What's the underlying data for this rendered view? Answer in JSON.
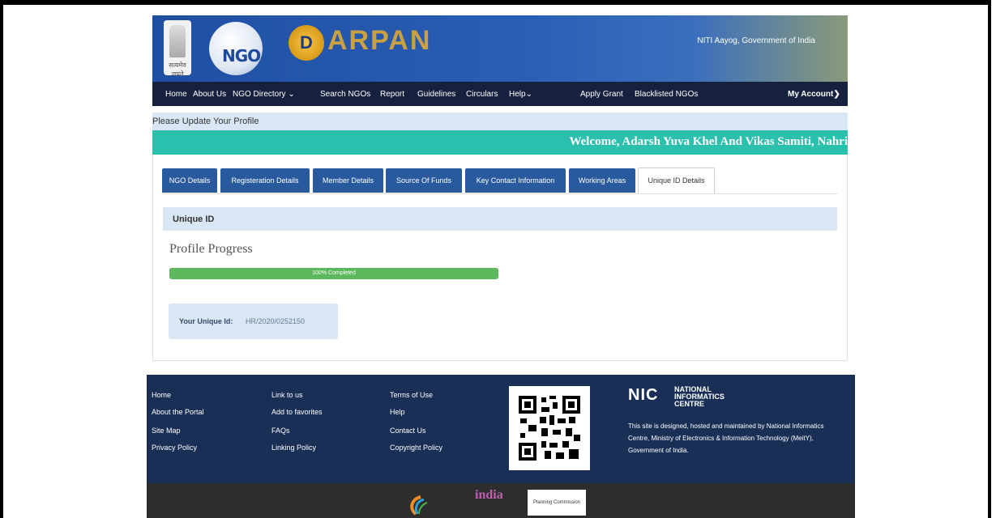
{
  "header": {
    "emblem_text": "सत्यमेव जयते",
    "ngo_logo_text": "NGO",
    "darpan_d": "D",
    "darpan_rest": "ARPAN",
    "org": "NITI Aayog, Government of India"
  },
  "nav": {
    "items": [
      "Home",
      "About Us",
      "NGO Directory",
      "Search NGOs",
      "Report",
      "Guidelines",
      "Circulars",
      "Help",
      "Apply Grant",
      "Blacklisted NGOs"
    ],
    "account": "My Account"
  },
  "notice": "Please Update Your Profile",
  "welcome": "Welcome, Adarsh Yuva Khel And Vikas Samiti, Nahri",
  "tabs": [
    "NGO Details",
    "Registeration Details",
    "Member Details",
    "Source Of Funds",
    "Key Contact Information",
    "Working Areas",
    "Unique ID Details"
  ],
  "unique_section_title": "Unique ID",
  "progress": {
    "title": "Profile Progress",
    "percent": 100,
    "label": "100% Completed"
  },
  "unique_id": {
    "label": "Your Unique Id:",
    "value": "HR/2020/0252150"
  },
  "footer": {
    "col1": [
      "Home",
      "About the Portal",
      "Site Map",
      "Privacy Policy"
    ],
    "col2": [
      "Link to us",
      "Add to favorites",
      "FAQs",
      "Linking Policy"
    ],
    "col3": [
      "Terms of Use",
      "Help",
      "Contact Us",
      "Copyright Policy"
    ],
    "nic_logo": "NIC",
    "nic_name": [
      "NATIONAL",
      "INFORMATICS",
      "CENTRE"
    ],
    "nic_desc": "This site is designed, hosted and maintained by National Informatics Centre, Ministry of Electronics & Information Technology (MeitY), Government of India."
  },
  "bottom": {
    "india": "india",
    "planning": "Planning Commission"
  },
  "colors": {
    "header_blue": "#1f4fa3",
    "nav_dark": "#16213e",
    "welcome_teal": "#2bbfae",
    "tab_blue": "#2a5a9e",
    "progress_green": "#5cb85c",
    "footer_navy": "#1a2f56"
  }
}
